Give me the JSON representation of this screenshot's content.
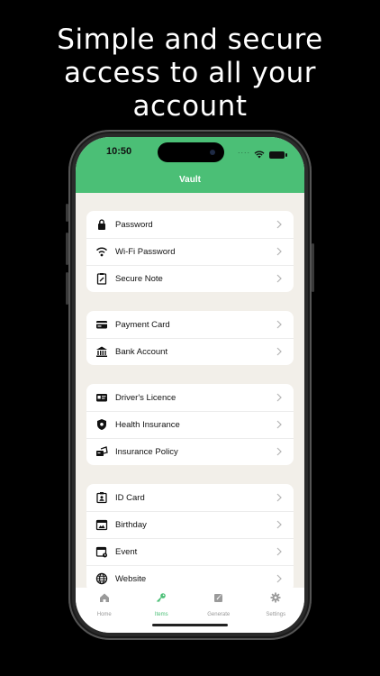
{
  "headline": [
    "Simple and secure",
    "access to all your",
    "account"
  ],
  "status_bar": {
    "time": "10:50",
    "dots": "...."
  },
  "nav": {
    "title": "Vault"
  },
  "groups": [
    {
      "items": [
        {
          "label": "Password",
          "icon": "lock-icon"
        },
        {
          "label": "Wi-Fi Password",
          "icon": "wifi-icon"
        },
        {
          "label": "Secure Note",
          "icon": "note-icon"
        }
      ]
    },
    {
      "items": [
        {
          "label": "Payment Card",
          "icon": "credit-card-icon"
        },
        {
          "label": "Bank Account",
          "icon": "bank-icon"
        }
      ]
    },
    {
      "items": [
        {
          "label": "Driver's Licence",
          "icon": "license-icon"
        },
        {
          "label": "Health Insurance",
          "icon": "shield-icon"
        },
        {
          "label": "Insurance Policy",
          "icon": "policy-icon"
        }
      ]
    },
    {
      "items": [
        {
          "label": "ID Card",
          "icon": "id-card-icon"
        },
        {
          "label": "Birthday",
          "icon": "birthday-icon"
        },
        {
          "label": "Event",
          "icon": "event-icon"
        },
        {
          "label": "Website",
          "icon": "globe-icon"
        }
      ]
    }
  ],
  "tabs": [
    {
      "label": "Home",
      "icon": "home-icon",
      "active": false
    },
    {
      "label": "Items",
      "icon": "key-icon",
      "active": true
    },
    {
      "label": "Generate",
      "icon": "generate-icon",
      "active": false
    },
    {
      "label": "Settings",
      "icon": "gear-icon",
      "active": false
    }
  ],
  "colors": {
    "accent": "#4bbf76",
    "background": "#f2efe9",
    "inactive_tab": "#999999"
  }
}
